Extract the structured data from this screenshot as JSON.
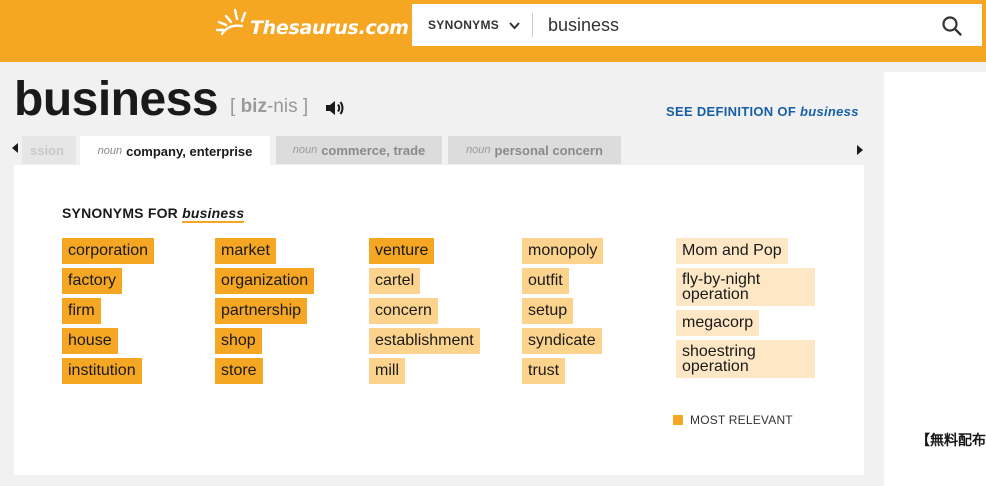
{
  "header": {
    "logo_text": "Thesaurus.com",
    "search_scope": "SYNONYMS",
    "search_value": "business"
  },
  "word": {
    "headword": "business",
    "pron_open": "[ ",
    "pron_syllable": "biz",
    "pron_rest": "-nis ]",
    "see_definition_prefix": "SEE DEFINITION OF ",
    "see_definition_word": "business"
  },
  "tabs": {
    "left_partial": "ssion",
    "active": {
      "pos": "noun",
      "label": "company, enterprise"
    },
    "second": {
      "pos": "noun",
      "label": "commerce, trade"
    },
    "third": {
      "pos": "noun",
      "label": "personal concern"
    }
  },
  "synonyms": {
    "title_prefix": "SYNONYMS FOR ",
    "title_word": "business",
    "columns": [
      [
        {
          "text": "corporation",
          "rel": "most"
        },
        {
          "text": "factory",
          "rel": "most"
        },
        {
          "text": "firm",
          "rel": "most"
        },
        {
          "text": "house",
          "rel": "most"
        },
        {
          "text": "institution",
          "rel": "most"
        }
      ],
      [
        {
          "text": "market",
          "rel": "most"
        },
        {
          "text": "organization",
          "rel": "most"
        },
        {
          "text": "partnership",
          "rel": "most"
        },
        {
          "text": "shop",
          "rel": "most"
        },
        {
          "text": "store",
          "rel": "most"
        }
      ],
      [
        {
          "text": "venture",
          "rel": "most"
        },
        {
          "text": "cartel",
          "rel": "mid"
        },
        {
          "text": "concern",
          "rel": "mid"
        },
        {
          "text": "establishment",
          "rel": "mid"
        },
        {
          "text": "mill",
          "rel": "mid"
        }
      ],
      [
        {
          "text": "monopoly",
          "rel": "mid"
        },
        {
          "text": "outfit",
          "rel": "mid"
        },
        {
          "text": "setup",
          "rel": "mid"
        },
        {
          "text": "syndicate",
          "rel": "mid"
        },
        {
          "text": "trust",
          "rel": "mid"
        }
      ],
      [
        {
          "text": "Mom and Pop",
          "rel": "low"
        },
        {
          "text": "fly-by-night operation",
          "rel": "low"
        },
        {
          "text": "megacorp",
          "rel": "low"
        },
        {
          "text": "shoestring operation",
          "rel": "low"
        }
      ]
    ],
    "legend_label": "MOST RELEVANT"
  },
  "sidebar": {
    "partial_text": "【無料配布"
  },
  "colors": {
    "brand_orange": "#f5a623",
    "relevance_most": "#f5a623",
    "relevance_mid": "#fbd38d",
    "relevance_low": "#fde7c4",
    "link_blue": "#1760a8"
  }
}
